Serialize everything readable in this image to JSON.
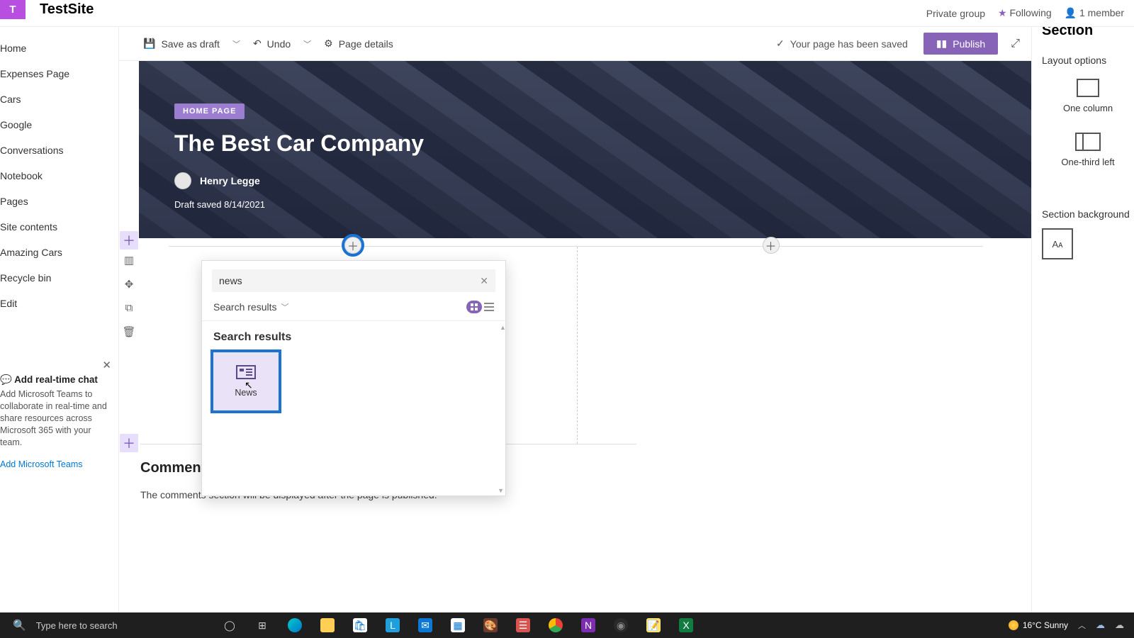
{
  "header": {
    "logo_letter": "T",
    "site_title": "TestSite",
    "privacy": "Private group",
    "following": "Following",
    "members": "1 member"
  },
  "left_nav": {
    "items": [
      "Home",
      "Expenses Page",
      "Cars",
      "Google",
      "Conversations",
      "Notebook",
      "Pages",
      "Site contents",
      "Amazing Cars",
      "Recycle bin",
      "Edit"
    ]
  },
  "promo": {
    "title": "Add real-time chat",
    "text": "Add Microsoft Teams to collaborate in real-time and share resources across Microsoft 365 with your team.",
    "link": "Add Microsoft Teams"
  },
  "cmdbar": {
    "save_draft": "Save as draft",
    "undo": "Undo",
    "page_details": "Page details",
    "saved_msg": "Your page has been saved",
    "publish": "Publish"
  },
  "hero": {
    "badge": "HOME PAGE",
    "title": "The Best Car Company",
    "author": "Henry Legge",
    "draft": "Draft saved 8/14/2021"
  },
  "picker": {
    "search_value": "news",
    "filter_label": "Search results",
    "section_title": "Search results",
    "item1": "News"
  },
  "comments": {
    "title": "Comments",
    "note": "The comments section will be displayed after the page is published."
  },
  "right_panel": {
    "title": "Section",
    "layout_label": "Layout options",
    "one_column": "One column",
    "one_third_left": "One-third left",
    "bg_label": "Section background",
    "aa": "Aᴀ"
  },
  "taskbar": {
    "search_placeholder": "Type here to search",
    "weather": "16°C  Sunny"
  }
}
